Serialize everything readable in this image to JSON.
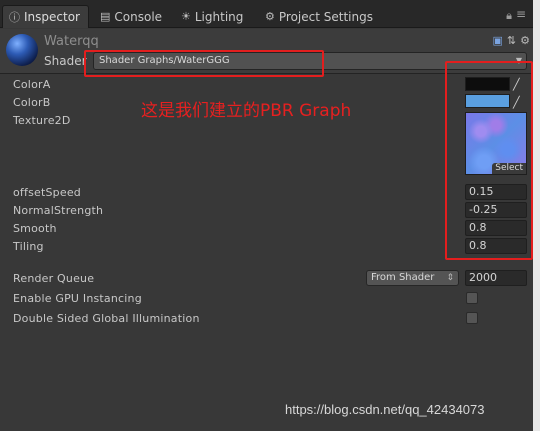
{
  "tabs": [
    {
      "label": "Inspector",
      "icon": "info-icon",
      "active": true
    },
    {
      "label": "Console",
      "icon": "console-icon",
      "active": false
    },
    {
      "label": "Lighting",
      "icon": "lightbulb-icon",
      "active": false
    },
    {
      "label": "Project Settings",
      "icon": "gear-icon",
      "active": false
    }
  ],
  "material": {
    "name": "Waterqq",
    "shader_label": "Shader",
    "shader_value": "Shader Graphs/WaterGGG"
  },
  "properties": {
    "colorA": {
      "label": "ColorA",
      "color": "#0d0d0d"
    },
    "colorB": {
      "label": "ColorB",
      "color": "#5a9fe0"
    },
    "texture": {
      "label": "Texture2D",
      "select_label": "Select"
    },
    "offsetSpeed": {
      "label": "offsetSpeed",
      "value": "0.15"
    },
    "normalStrength": {
      "label": "NormalStrength",
      "value": "-0.25"
    },
    "smooth": {
      "label": "Smooth",
      "value": "0.8"
    },
    "tiling": {
      "label": "Tiling",
      "value": "0.8"
    }
  },
  "render_queue": {
    "label": "Render Queue",
    "mode": "From Shader",
    "value": "2000"
  },
  "gpu_instancing": {
    "label": "Enable GPU Instancing",
    "checked": false
  },
  "double_sided_gi": {
    "label": "Double Sided Global Illumination",
    "checked": false
  },
  "annotation": {
    "text": "这是我们建立的PBR Graph",
    "color": "#e62020"
  },
  "watermark": "https://blog.csdn.net/qq_42434073"
}
